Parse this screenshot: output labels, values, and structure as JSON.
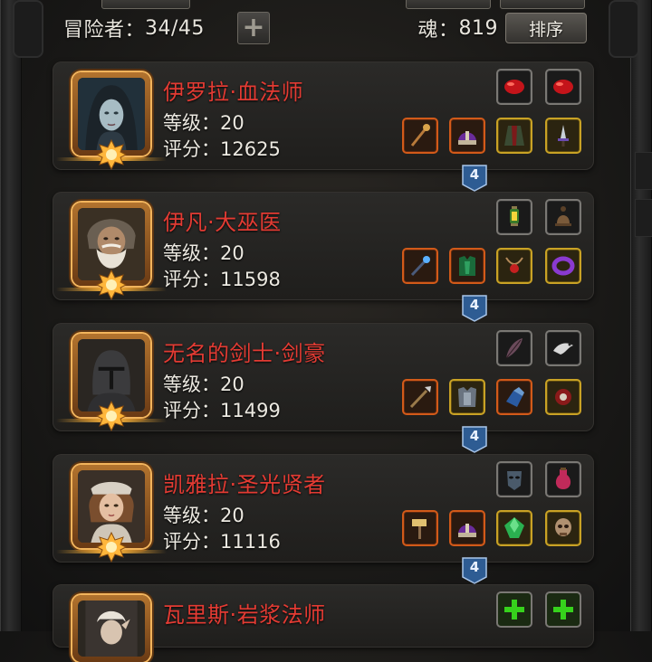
{
  "header": {
    "adventurer_label": "冒险者：",
    "adventurer_count": "34/45",
    "add_label": "+",
    "soul_label": "魂：",
    "soul_value": "819",
    "sort_label": "排序"
  },
  "heroes": [
    {
      "name": "伊罗拉·血法师",
      "level": "等级：20",
      "score": "评分：12625",
      "link": "4",
      "top_items": [
        "red-gem-icon",
        "red-gem-icon"
      ],
      "bottom_items": [
        "staff-icon",
        "purple-helmet-icon",
        "green-robe-icon",
        "dagger-icon"
      ]
    },
    {
      "name": "伊凡·大巫医",
      "level": "等级：20",
      "score": "评分：11598",
      "link": "4",
      "top_items": [
        "lantern-icon",
        "bell-icon"
      ],
      "bottom_items": [
        "wand-icon",
        "green-armor-icon",
        "amulet-icon",
        "purple-ring-icon"
      ]
    },
    {
      "name": "无名的剑士·剑豪",
      "level": "等级：20",
      "score": "评分：11499",
      "link": "4",
      "top_items": [
        "feather-icon",
        "white-bird-icon"
      ],
      "bottom_items": [
        "spear-icon",
        "steel-armor-icon",
        "blue-gauntlet-icon",
        "red-shoulder-icon"
      ]
    },
    {
      "name": "凯雅拉·圣光贤者",
      "level": "等级：20",
      "score": "评分：11116",
      "link": "4",
      "top_items": [
        "mask-icon",
        "red-bottle-icon"
      ],
      "bottom_items": [
        "hammer-icon",
        "purple-helmet-icon",
        "green-gem-icon",
        "skull-mask-icon"
      ]
    },
    {
      "name": "瓦里斯·岩浆法师",
      "level": "",
      "score": "",
      "link": "",
      "top_items": [
        "green-plus-icon",
        "green-plus-icon"
      ],
      "bottom_items": []
    }
  ],
  "colors": {
    "name_red": "#e33b33",
    "slot_orange": "#d25a19",
    "slot_gold": "#c9a225",
    "badge_blue": "#2e5c93"
  }
}
